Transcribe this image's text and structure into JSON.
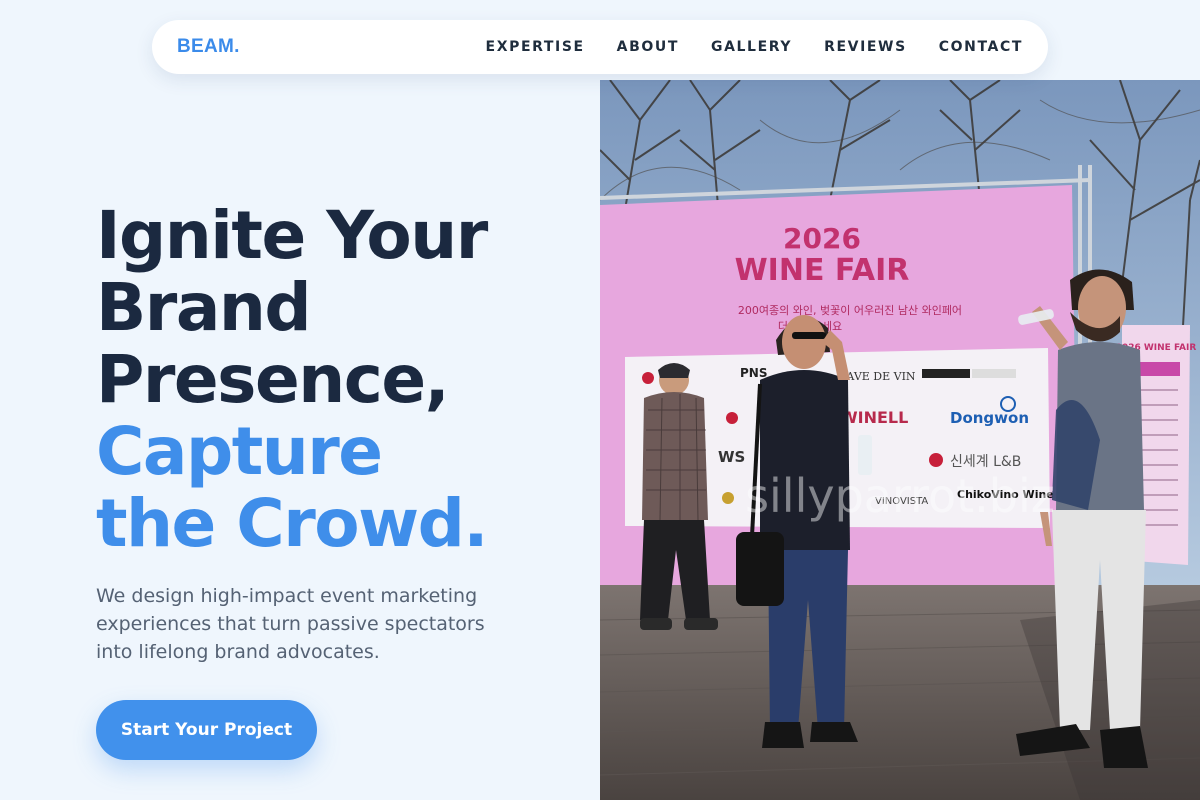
{
  "nav": {
    "logo": "BEAM.",
    "links": [
      "EXPERTISE",
      "ABOUT",
      "GALLERY",
      "REVIEWS",
      "CONTACT"
    ]
  },
  "hero": {
    "headline_dark": [
      "Ignite Your",
      "Brand",
      "Presence,"
    ],
    "headline_accent": [
      "Capture",
      "the Crowd."
    ],
    "subcopy": "We design high-impact event marketing experiences that turn passive spectators into lifelong brand advocates.",
    "cta_label": "Start Your Project"
  },
  "photo": {
    "banner_year": "2026",
    "banner_title": "WINE FAIR",
    "banner_korean_line1": "200여종의 와인, 벚꽃이 어우러진 남산 와인페어",
    "banner_korean_line2": "더 찾아보세요",
    "sponsors": [
      "PNS",
      "CAVE DE VIN",
      "WINELL",
      "Dongwon",
      "WS",
      "신세계 L&B",
      "ChikoVino Wine",
      "VINOVISTA"
    ],
    "side_banner": "2026 WINE FAIR",
    "watermark": "sillyparrot.biz"
  },
  "colors": {
    "background": "#eff6fd",
    "brand": "#3b8bea",
    "headline_dark": "#1b2940",
    "accent": "#3f8eea",
    "banner_pink": "#e7a7de"
  }
}
